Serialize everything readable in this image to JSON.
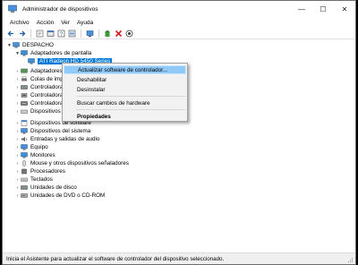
{
  "window": {
    "title": "Administrador de dispositivos",
    "minimize_glyph": "—",
    "maximize_glyph": "☐",
    "close_glyph": "✕"
  },
  "menubar": [
    "Archivo",
    "Acción",
    "Ver",
    "Ayuda"
  ],
  "toolbar": {
    "icons": [
      "back-icon",
      "forward-icon",
      "properties-icon",
      "details-icon",
      "help-icon",
      "list-view-icon",
      "scan-hardware-icon",
      "update-driver-icon",
      "uninstall-icon",
      "disable-icon"
    ]
  },
  "tree": {
    "root": "DESPACHO",
    "items": [
      {
        "label": "Adaptadores de pantalla",
        "expanded": true
      },
      {
        "label": "ATI Radeon HD 5450 Series",
        "child": true,
        "selected": true
      },
      {
        "label": "Adaptadores de red"
      },
      {
        "label": "Colas de impresión"
      },
      {
        "label": "Controladoras de almacenamiento"
      },
      {
        "label": "Controladoras de bus serie universal"
      },
      {
        "label": "Controladoras IDE ATA/ATAPI"
      },
      {
        "label": "Dispositivos de interfaz humana"
      },
      {
        "label": "Dispositivos de software"
      },
      {
        "label": "Dispositivos del sistema"
      },
      {
        "label": "Entradas y salidas de audio"
      },
      {
        "label": "Equipo"
      },
      {
        "label": "Monitores"
      },
      {
        "label": "Mouse y otros dispositivos señaladores"
      },
      {
        "label": "Procesadores"
      },
      {
        "label": "Teclados"
      },
      {
        "label": "Unidades de disco"
      },
      {
        "label": "Unidades de DVD o CD-ROM"
      }
    ]
  },
  "context_menu": {
    "update_driver": "Actualizar software de controlador...",
    "disable": "Deshabilitar",
    "uninstall": "Desinstalar",
    "scan": "Buscar cambios de hardware",
    "properties": "Propiedades"
  },
  "statusbar": {
    "text": "Inicia el Asistente para actualizar el software de controlador del dispositivo seleccionado."
  },
  "colors": {
    "selection": "#0078d7",
    "menu_highlight": "#91c9f7",
    "close_red": "#e81123"
  }
}
